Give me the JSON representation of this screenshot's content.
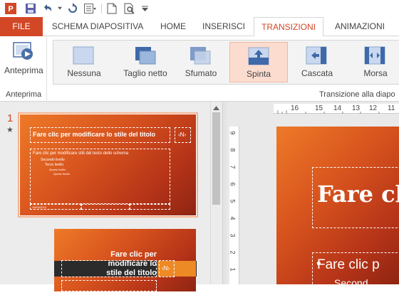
{
  "qat": {
    "icons": [
      "powerpoint-app-icon",
      "save-icon",
      "undo-icon",
      "undo-dropdown-icon",
      "repeat-icon",
      "layout-icon",
      "new-icon",
      "print-preview-icon",
      "qat-customize-icon"
    ]
  },
  "tabs": {
    "file": "FILE",
    "items": [
      "SCHEMA DIAPOSITIVA",
      "HOME",
      "INSERISCI",
      "TRANSIZIONI",
      "ANIMAZIONI"
    ],
    "active": "TRANSIZIONI"
  },
  "ribbon": {
    "preview_label": "Anteprima",
    "preview_group_label": "Anteprima",
    "transitions_group_label": "Transizione alla diapo",
    "transitions": [
      {
        "label": "Nessuna"
      },
      {
        "label": "Taglio netto"
      },
      {
        "label": "Sfumato"
      },
      {
        "label": "Spinta",
        "selected": true
      },
      {
        "label": "Cascata"
      },
      {
        "label": "Morsa"
      }
    ]
  },
  "thumbnails": {
    "slide_number": "1",
    "star": "★",
    "slide1": {
      "title": "Fare clic per modificare lo stile del titolo",
      "num_placeholder": "‹N›",
      "body": [
        "Fare clic per modificare stili del testo dello schema",
        "Secondo livello",
        "Terzo livello",
        "Quarto livello",
        "Quinto livello"
      ],
      "date": "19/03/2013"
    },
    "slide2": {
      "title": "Fare clic per modificare lo stile del titolo",
      "num_placeholder": "‹N›"
    }
  },
  "ruler": {
    "h_numbers": [
      "16",
      "15",
      "14",
      "13",
      "12",
      "11"
    ],
    "v_numbers": [
      "9",
      "8",
      "7",
      "6",
      "5",
      "4",
      "3",
      "2",
      "1"
    ]
  },
  "canvas": {
    "title": "Fare cli",
    "bullet": "Fare clic p",
    "sub_bullet": "Second"
  },
  "colors": {
    "accent": "#d24726",
    "selected_transition": "#fcdccf"
  }
}
